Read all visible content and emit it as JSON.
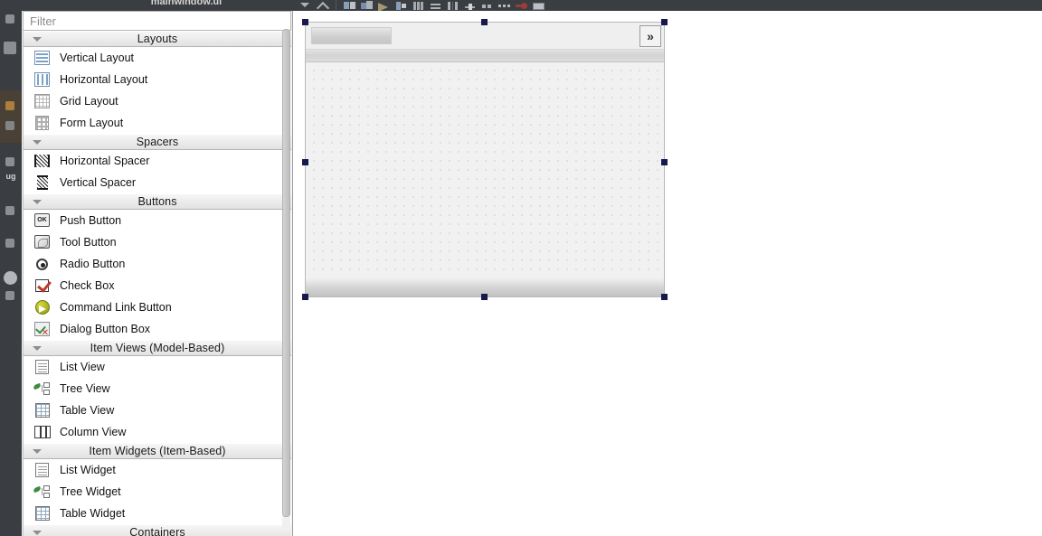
{
  "app": {
    "window_title": "mainwindow.ui"
  },
  "toolbar": {
    "icons": [
      {
        "name": "caret-down-icon",
        "glyph": "caret"
      },
      {
        "name": "chevron-up-icon",
        "glyph": "chev"
      },
      {
        "name": "edit-widgets-icon",
        "glyph": "sq1"
      },
      {
        "name": "edit-signals-slots-icon",
        "glyph": "sq3"
      },
      {
        "name": "edit-buddies-icon",
        "glyph": "arrow"
      },
      {
        "name": "edit-tab-order-icon",
        "glyph": "barA"
      },
      {
        "name": "layout-horizontally-icon",
        "glyph": "v"
      },
      {
        "name": "layout-vertically-icon",
        "glyph": "h"
      },
      {
        "name": "layout-splitter-horizontal-icon",
        "glyph": "p"
      },
      {
        "name": "layout-in-form-icon",
        "glyph": "sl"
      },
      {
        "name": "layout-grid-icon",
        "glyph": "d"
      },
      {
        "name": "break-layout-icon",
        "glyph": "t"
      },
      {
        "name": "adjust-size-icon",
        "glyph": "red"
      },
      {
        "name": "preview-icon",
        "glyph": "img"
      }
    ]
  },
  "modebar": {
    "items": [
      {
        "name": "mode-welcome",
        "label": ""
      },
      {
        "name": "mode-edit",
        "label": ""
      },
      {
        "name": "mode-design",
        "label": "",
        "selected": true
      },
      {
        "name": "mode-debug",
        "label": "ug"
      },
      {
        "name": "mode-projects",
        "label": ""
      },
      {
        "name": "mode-help",
        "label": ""
      },
      {
        "name": "mode-run",
        "label": ""
      }
    ]
  },
  "widget_box": {
    "filter": {
      "value": "",
      "placeholder": "Filter"
    },
    "groups": [
      {
        "name": "layouts",
        "title": "Layouts",
        "expanded": true,
        "items": [
          {
            "label": "Vertical Layout",
            "icon": "vertical-layout-icon"
          },
          {
            "label": "Horizontal Layout",
            "icon": "horizontal-layout-icon"
          },
          {
            "label": "Grid Layout",
            "icon": "grid-layout-icon"
          },
          {
            "label": "Form Layout",
            "icon": "form-layout-icon"
          }
        ]
      },
      {
        "name": "spacers",
        "title": "Spacers",
        "expanded": true,
        "items": [
          {
            "label": "Horizontal Spacer",
            "icon": "horizontal-spacer-icon"
          },
          {
            "label": "Vertical Spacer",
            "icon": "vertical-spacer-icon"
          }
        ]
      },
      {
        "name": "buttons",
        "title": "Buttons",
        "expanded": true,
        "items": [
          {
            "label": "Push Button",
            "icon": "push-button-icon"
          },
          {
            "label": "Tool Button",
            "icon": "tool-button-icon"
          },
          {
            "label": "Radio Button",
            "icon": "radio-button-icon"
          },
          {
            "label": "Check Box",
            "icon": "check-box-icon"
          },
          {
            "label": "Command Link Button",
            "icon": "command-link-button-icon"
          },
          {
            "label": "Dialog Button Box",
            "icon": "dialog-button-box-icon"
          }
        ]
      },
      {
        "name": "item-views",
        "title": "Item Views (Model-Based)",
        "expanded": true,
        "items": [
          {
            "label": "List View",
            "icon": "list-view-icon"
          },
          {
            "label": "Tree View",
            "icon": "tree-view-icon"
          },
          {
            "label": "Table View",
            "icon": "table-view-icon"
          },
          {
            "label": "Column View",
            "icon": "column-view-icon"
          }
        ]
      },
      {
        "name": "item-widgets",
        "title": "Item Widgets (Item-Based)",
        "expanded": true,
        "items": [
          {
            "label": "List Widget",
            "icon": "list-widget-icon"
          },
          {
            "label": "Tree Widget",
            "icon": "tree-widget-icon"
          },
          {
            "label": "Table Widget",
            "icon": "table-widget-icon"
          }
        ]
      },
      {
        "name": "containers",
        "title": "Containers",
        "expanded": true,
        "items": []
      }
    ]
  },
  "form_editor": {
    "selected": true,
    "toolbar": {
      "extension_button_label": "»"
    },
    "menubar": {
      "items": []
    },
    "central_widget": {
      "grid": true
    },
    "statusbar": {
      "text": ""
    }
  },
  "colors": {
    "selection_handle": "#17184b",
    "chrome_dark": "#3a3d41",
    "panel_bg": "#f2f2f2",
    "form_bg": "#f1f1f1"
  }
}
